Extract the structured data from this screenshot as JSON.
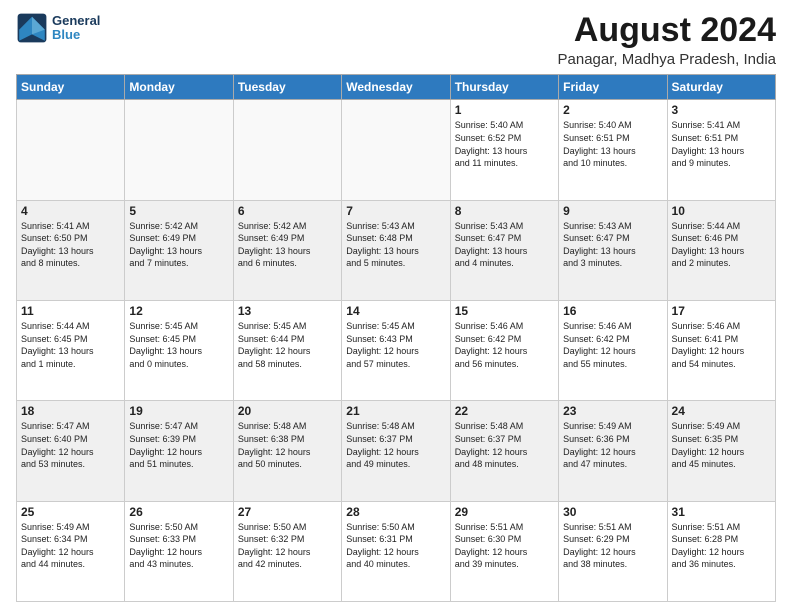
{
  "logo": {
    "line1": "General",
    "line2": "Blue"
  },
  "title": "August 2024",
  "subtitle": "Panagar, Madhya Pradesh, India",
  "days_of_week": [
    "Sunday",
    "Monday",
    "Tuesday",
    "Wednesday",
    "Thursday",
    "Friday",
    "Saturday"
  ],
  "weeks": [
    [
      {
        "day": "",
        "info": ""
      },
      {
        "day": "",
        "info": ""
      },
      {
        "day": "",
        "info": ""
      },
      {
        "day": "",
        "info": ""
      },
      {
        "day": "1",
        "info": "Sunrise: 5:40 AM\nSunset: 6:52 PM\nDaylight: 13 hours\nand 11 minutes."
      },
      {
        "day": "2",
        "info": "Sunrise: 5:40 AM\nSunset: 6:51 PM\nDaylight: 13 hours\nand 10 minutes."
      },
      {
        "day": "3",
        "info": "Sunrise: 5:41 AM\nSunset: 6:51 PM\nDaylight: 13 hours\nand 9 minutes."
      }
    ],
    [
      {
        "day": "4",
        "info": "Sunrise: 5:41 AM\nSunset: 6:50 PM\nDaylight: 13 hours\nand 8 minutes."
      },
      {
        "day": "5",
        "info": "Sunrise: 5:42 AM\nSunset: 6:49 PM\nDaylight: 13 hours\nand 7 minutes."
      },
      {
        "day": "6",
        "info": "Sunrise: 5:42 AM\nSunset: 6:49 PM\nDaylight: 13 hours\nand 6 minutes."
      },
      {
        "day": "7",
        "info": "Sunrise: 5:43 AM\nSunset: 6:48 PM\nDaylight: 13 hours\nand 5 minutes."
      },
      {
        "day": "8",
        "info": "Sunrise: 5:43 AM\nSunset: 6:47 PM\nDaylight: 13 hours\nand 4 minutes."
      },
      {
        "day": "9",
        "info": "Sunrise: 5:43 AM\nSunset: 6:47 PM\nDaylight: 13 hours\nand 3 minutes."
      },
      {
        "day": "10",
        "info": "Sunrise: 5:44 AM\nSunset: 6:46 PM\nDaylight: 13 hours\nand 2 minutes."
      }
    ],
    [
      {
        "day": "11",
        "info": "Sunrise: 5:44 AM\nSunset: 6:45 PM\nDaylight: 13 hours\nand 1 minute."
      },
      {
        "day": "12",
        "info": "Sunrise: 5:45 AM\nSunset: 6:45 PM\nDaylight: 13 hours\nand 0 minutes."
      },
      {
        "day": "13",
        "info": "Sunrise: 5:45 AM\nSunset: 6:44 PM\nDaylight: 12 hours\nand 58 minutes."
      },
      {
        "day": "14",
        "info": "Sunrise: 5:45 AM\nSunset: 6:43 PM\nDaylight: 12 hours\nand 57 minutes."
      },
      {
        "day": "15",
        "info": "Sunrise: 5:46 AM\nSunset: 6:42 PM\nDaylight: 12 hours\nand 56 minutes."
      },
      {
        "day": "16",
        "info": "Sunrise: 5:46 AM\nSunset: 6:42 PM\nDaylight: 12 hours\nand 55 minutes."
      },
      {
        "day": "17",
        "info": "Sunrise: 5:46 AM\nSunset: 6:41 PM\nDaylight: 12 hours\nand 54 minutes."
      }
    ],
    [
      {
        "day": "18",
        "info": "Sunrise: 5:47 AM\nSunset: 6:40 PM\nDaylight: 12 hours\nand 53 minutes."
      },
      {
        "day": "19",
        "info": "Sunrise: 5:47 AM\nSunset: 6:39 PM\nDaylight: 12 hours\nand 51 minutes."
      },
      {
        "day": "20",
        "info": "Sunrise: 5:48 AM\nSunset: 6:38 PM\nDaylight: 12 hours\nand 50 minutes."
      },
      {
        "day": "21",
        "info": "Sunrise: 5:48 AM\nSunset: 6:37 PM\nDaylight: 12 hours\nand 49 minutes."
      },
      {
        "day": "22",
        "info": "Sunrise: 5:48 AM\nSunset: 6:37 PM\nDaylight: 12 hours\nand 48 minutes."
      },
      {
        "day": "23",
        "info": "Sunrise: 5:49 AM\nSunset: 6:36 PM\nDaylight: 12 hours\nand 47 minutes."
      },
      {
        "day": "24",
        "info": "Sunrise: 5:49 AM\nSunset: 6:35 PM\nDaylight: 12 hours\nand 45 minutes."
      }
    ],
    [
      {
        "day": "25",
        "info": "Sunrise: 5:49 AM\nSunset: 6:34 PM\nDaylight: 12 hours\nand 44 minutes."
      },
      {
        "day": "26",
        "info": "Sunrise: 5:50 AM\nSunset: 6:33 PM\nDaylight: 12 hours\nand 43 minutes."
      },
      {
        "day": "27",
        "info": "Sunrise: 5:50 AM\nSunset: 6:32 PM\nDaylight: 12 hours\nand 42 minutes."
      },
      {
        "day": "28",
        "info": "Sunrise: 5:50 AM\nSunset: 6:31 PM\nDaylight: 12 hours\nand 40 minutes."
      },
      {
        "day": "29",
        "info": "Sunrise: 5:51 AM\nSunset: 6:30 PM\nDaylight: 12 hours\nand 39 minutes."
      },
      {
        "day": "30",
        "info": "Sunrise: 5:51 AM\nSunset: 6:29 PM\nDaylight: 12 hours\nand 38 minutes."
      },
      {
        "day": "31",
        "info": "Sunrise: 5:51 AM\nSunset: 6:28 PM\nDaylight: 12 hours\nand 36 minutes."
      }
    ]
  ]
}
